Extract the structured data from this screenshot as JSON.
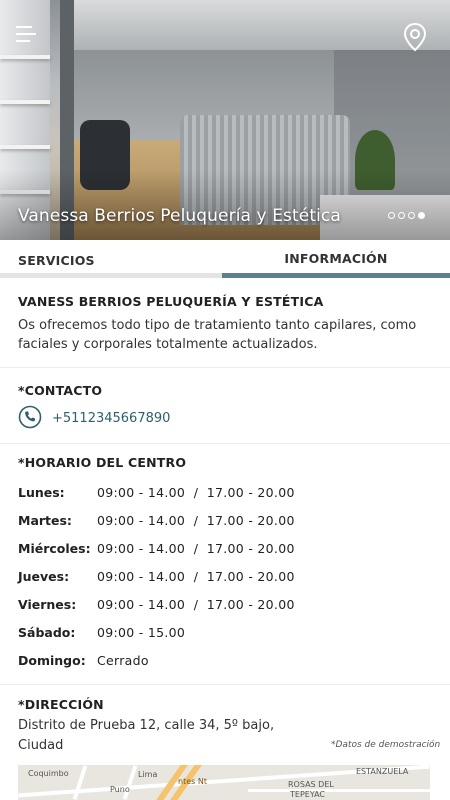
{
  "header": {
    "title": "Vanessa Berrios Peluquería y Estética",
    "menu_icon": "hamburger-menu-icon",
    "location_icon": "map-pin-icon",
    "carousel": {
      "count": 4,
      "active_index": 3
    }
  },
  "tabs": [
    {
      "label": "SERVICIOS",
      "active": false
    },
    {
      "label": "INFORMACIÓN",
      "active": true
    }
  ],
  "business": {
    "name": "VANESS BERRIOS PELUQUERÍA Y ESTÉTICA",
    "description_line1": "Os ofrecemos todo tipo de tratamiento tanto capilares, como",
    "description_line2": "faciales y corporales totalmente actualizados."
  },
  "contact": {
    "title": "*CONTACTO",
    "icon": "phone-icon",
    "phone": "+5112345667890"
  },
  "schedule": {
    "title": "*HORARIO DEL CENTRO",
    "days": [
      {
        "day": "Lunes:",
        "hours": "09:00 - 14.00  /  17.00 - 20.00"
      },
      {
        "day": "Martes:",
        "hours": "09:00 - 14.00  /  17.00 - 20.00"
      },
      {
        "day": "Miércoles:",
        "hours": "09:00 - 14.00  /  17.00 - 20.00"
      },
      {
        "day": "Jueves:",
        "hours": "09:00 - 14.00  /  17.00 - 20.00"
      },
      {
        "day": "Viernes:",
        "hours": "09:00 - 14.00  /  17.00 - 20.00"
      },
      {
        "day": "Sábado:",
        "hours": "09:00 - 15.00"
      },
      {
        "day": "Domingo:",
        "hours": "Cerrado"
      }
    ]
  },
  "address": {
    "title": "*DIRECCIÓN",
    "line1": "Distrito de Prueba 12, calle 34, 5º bajo,",
    "line2": "Ciudad",
    "note": "*Datos de demostración"
  },
  "map": {
    "labels": [
      "Coquimbo",
      "Puno",
      "Lima",
      "ntes Nt",
      "ESTANZUELA",
      "ROSAS DEL",
      "TEPEYAC"
    ],
    "colors": {
      "land": "#e9e6df",
      "road": "#ffffff",
      "highway": "#f5c36b"
    }
  },
  "colors": {
    "accent": "#5f7f8a",
    "phone_link": "#2d5f6e",
    "inactive_tab_bar": "#e4e4e4"
  }
}
